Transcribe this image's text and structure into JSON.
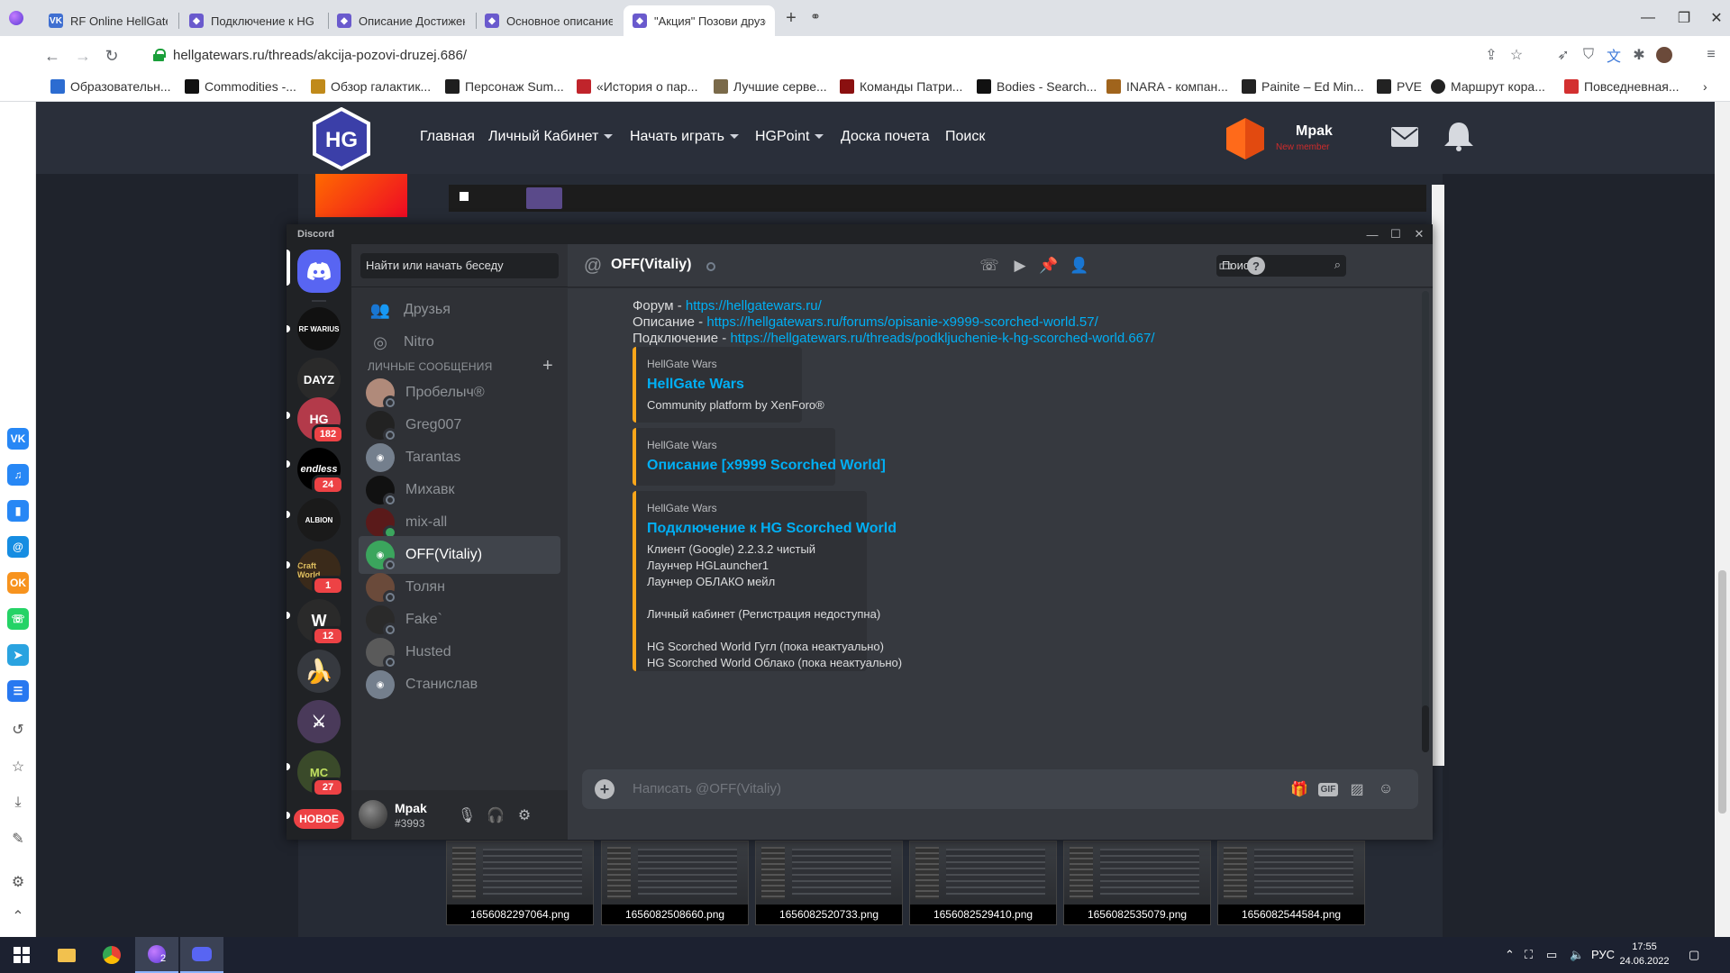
{
  "browser": {
    "tabs": [
      {
        "title": "RF Online HellGate Wars",
        "color": "#3f6fd1"
      },
      {
        "title": "Подключение к HG Scorched",
        "color": "#6a5acd"
      },
      {
        "title": "Описание Достижений | Hell",
        "color": "#6a5acd"
      },
      {
        "title": "Основное описание сервера",
        "color": "#6a5acd"
      },
      {
        "title": "\"Акция\" Позови друзей | Hel",
        "color": "#6a5acd"
      }
    ],
    "new_tab": "+",
    "url": "hellgatewars.ru/threads/akcija-pozovi-druzej.686/",
    "bookmarks": [
      {
        "label": "Образовательн...",
        "color": "#2c6cd1"
      },
      {
        "label": "Commodities -...",
        "color": "#111111"
      },
      {
        "label": "Обзор галактик...",
        "color": "#c08a1a"
      },
      {
        "label": "Персонаж Sum...",
        "color": "#1e1e1e"
      },
      {
        "label": "«История о пар...",
        "color": "#c0242b"
      },
      {
        "label": "Лучшие серве...",
        "color": "#7a6a4a"
      },
      {
        "label": "Команды Патри...",
        "color": "#8a1010"
      },
      {
        "label": "Bodies - Search...",
        "color": "#111111"
      },
      {
        "label": "INARA - компан...",
        "color": "#a0641c"
      },
      {
        "label": "Painite – Ed Min...",
        "color": "#222222"
      },
      {
        "label": "PVE",
        "color": "#222222"
      },
      {
        "label": "Маршрут кора...",
        "color": "#222222"
      },
      {
        "label": "Повседневная...",
        "color": "#d33030"
      }
    ]
  },
  "ysidebar": {
    "apps": [
      {
        "icon": "vk-icon",
        "text": "VK",
        "color": "#2787f5"
      },
      {
        "icon": "music-icon",
        "text": "♫",
        "color": "#2787f5"
      },
      {
        "icon": "stats-icon",
        "text": "▮",
        "color": "#2787f5"
      },
      {
        "icon": "mail-icon",
        "text": "@",
        "color": "#168de2"
      },
      {
        "icon": "ok-icon",
        "text": "OK",
        "color": "#f7931e"
      },
      {
        "icon": "whatsapp-icon",
        "text": "☏",
        "color": "#25d366"
      },
      {
        "icon": "telegram-icon",
        "text": "➤",
        "color": "#2aa3e0"
      },
      {
        "icon": "list-icon",
        "text": "☰",
        "color": "#2878f0"
      }
    ]
  },
  "site": {
    "nav": [
      {
        "label": "Главная",
        "dropdown": false
      },
      {
        "label": "Личный Кабинет",
        "dropdown": true
      },
      {
        "label": "Начать играть",
        "dropdown": true
      },
      {
        "label": "HGPoint",
        "dropdown": true
      },
      {
        "label": "Доска почета",
        "dropdown": false
      },
      {
        "label": "Поиск",
        "dropdown": false
      }
    ],
    "username": "Mpak",
    "rank": "New member",
    "thumbnails": [
      "1656082297064.png",
      "1656082508660.png",
      "1656082520733.png",
      "1656082529410.png",
      "1656082535079.png",
      "1656082544584.png"
    ]
  },
  "discord": {
    "app_title": "Discord",
    "search_placeholder": "Найти или начать беседу",
    "nav": [
      {
        "label": "Друзья",
        "icon": "friends-icon"
      },
      {
        "label": "Nitro",
        "icon": "nitro-icon"
      }
    ],
    "dm_header": "ЛИЧНЫЕ СООБЩЕНИЯ",
    "guilds": [
      {
        "name": "rf-warius",
        "text": "RF WARIUS",
        "color": "#111111",
        "badge": null
      },
      {
        "name": "dayz",
        "text": "DAYZ",
        "color": "#2a2a2a",
        "badge": null
      },
      {
        "name": "hg",
        "text": "HG",
        "color": "#b33a4a",
        "badge": "182"
      },
      {
        "name": "endless",
        "text": "endless",
        "color": "#000000",
        "badge": "24"
      },
      {
        "name": "albion",
        "text": "ALBION",
        "color": "#1a1a1a",
        "badge": null
      },
      {
        "name": "craft-world",
        "text": "Craft World",
        "color": "#3a2a1a",
        "badge": "1"
      },
      {
        "name": "witcher",
        "text": "W",
        "color": "#2a2a2a",
        "badge": "12"
      },
      {
        "name": "banana",
        "text": "🍌",
        "color": "#36393f",
        "badge": null
      },
      {
        "name": "purple",
        "text": "⚔",
        "color": "#4a3a5a",
        "badge": null
      },
      {
        "name": "minecraft",
        "text": "MC",
        "color": "#3a4a2a",
        "badge": "27"
      }
    ],
    "new_badge": "НОВОЕ",
    "dms": [
      {
        "name": "Пробелыч®",
        "color": "#b08a7a",
        "online": false,
        "active": false
      },
      {
        "name": "Greg007",
        "color": "#222222",
        "online": false,
        "active": false
      },
      {
        "name": "Tarantas",
        "color": "#747f8d",
        "online": false,
        "active": false
      },
      {
        "name": "Михавк",
        "color": "#111111",
        "online": false,
        "active": false
      },
      {
        "name": "mix-all",
        "color": "#5a1a1a",
        "online": true,
        "active": false
      },
      {
        "name": "OFF(Vitaliy)",
        "color": "#3ba55d",
        "online": false,
        "active": true
      },
      {
        "name": "Толян",
        "color": "#6a4a3a",
        "online": false,
        "active": false
      },
      {
        "name": "Fake`",
        "color": "#2a2a2a",
        "online": false,
        "active": false
      },
      {
        "name": "Husted",
        "color": "#5a5a5a",
        "online": false,
        "active": false
      },
      {
        "name": "Станислав",
        "color": "#747f8d",
        "online": false,
        "active": false
      }
    ],
    "user": {
      "name": "Mpak",
      "tag": "#3993"
    },
    "chat": {
      "recipient": "OFF(Vitaliy)",
      "search_placeholder": "Поиск",
      "lines": [
        {
          "label": "Форум - ",
          "link": "https://hellgatewars.ru/"
        },
        {
          "label": "Описание - ",
          "link": "https://hellgatewars.ru/forums/opisanie-x9999-scorched-world.57/"
        },
        {
          "label": "Подключение - ",
          "link": "https://hellgatewars.ru/threads/podkljuchenie-k-hg-scorched-world.667/"
        }
      ],
      "embeds": [
        {
          "provider": "HellGate Wars",
          "title": "HellGate Wars",
          "desc": [
            "Community platform by XenForo®"
          ]
        },
        {
          "provider": "HellGate Wars",
          "title": "Описание [x9999 Scorched World]",
          "desc": []
        },
        {
          "provider": "HellGate Wars",
          "title": "Подключение к HG Scorched World",
          "desc": [
            "Клиент (Google) 2.2.3.2 чистый",
            "Лаунчер HGLauncher1",
            "Лаунчер ОБЛАКО мейл",
            "",
            "Личный кабинет (Регистрация недоступна)",
            "",
            "",
            "HG Scorched World Гугл (пока неактуально)",
            "HG Scorched World Облако (пока неактуально)"
          ]
        }
      ],
      "composer_placeholder": "Написать @OFF(Vitaliy)",
      "gif_label": "GIF"
    }
  },
  "taskbar": {
    "discord_badge": "2",
    "lang": "РУС",
    "time": "17:55",
    "date": "24.06.2022"
  }
}
